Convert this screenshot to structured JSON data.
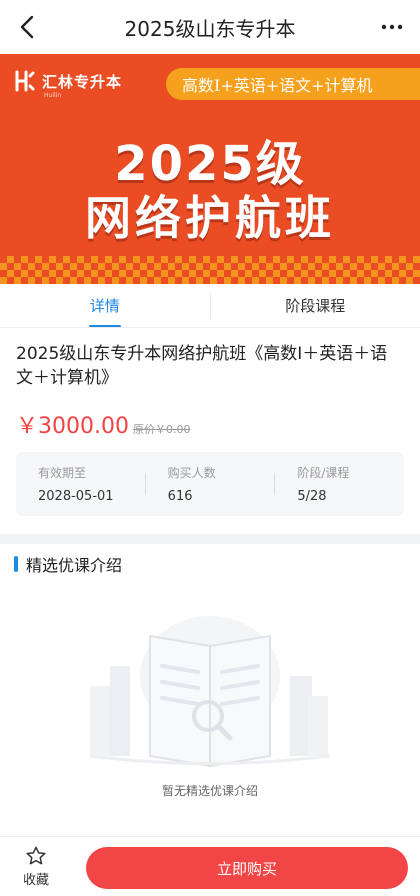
{
  "header": {
    "title": "2025级山东专升本",
    "back_icon": "chevron-left-icon",
    "more_icon": "more-horizontal-icon"
  },
  "banner": {
    "brand": "汇林专升本",
    "brand_sub": "Huilin",
    "subjects": "高数Ⅰ+英语+语文+计算机",
    "headline_line1": "2025级",
    "headline_line2": "网络护航班",
    "colors": {
      "background": "#ea4c24",
      "accent": "#f6a11d"
    }
  },
  "tabs": [
    {
      "label": "详情",
      "active": true
    },
    {
      "label": "阶段课程",
      "active": false
    }
  ],
  "course": {
    "name": "2025级山东专升本网络护航班《高数Ⅰ＋英语＋语文＋计算机》",
    "price": "￥3000.00",
    "original_price": "原价￥0.00",
    "stats": [
      {
        "label": "有效期至",
        "value": "2028-05-01"
      },
      {
        "label": "购买人数",
        "value": "616"
      },
      {
        "label": "阶段/课程",
        "value": "5/28"
      }
    ]
  },
  "intro": {
    "title": "精选优课介绍",
    "empty_text": "暂无精选优课介绍"
  },
  "bottom": {
    "favorite_label": "收藏",
    "favorite_icon": "star-outline-icon",
    "buy_label": "立即购买",
    "buy_color": "#f24646"
  }
}
